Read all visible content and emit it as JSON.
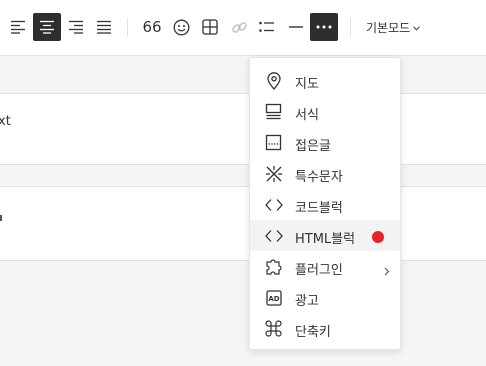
{
  "toolbar": {
    "buttons": [
      {
        "name": "align-left-icon"
      },
      {
        "name": "align-center-icon",
        "active": true
      },
      {
        "name": "align-right-icon"
      },
      {
        "name": "align-justify-icon"
      },
      {
        "name": "quote-icon",
        "glyph": "66"
      },
      {
        "name": "emoji-icon"
      },
      {
        "name": "table-icon"
      },
      {
        "name": "link-icon"
      },
      {
        "name": "list-icon"
      },
      {
        "name": "horizontal-rule-icon"
      },
      {
        "name": "more-icon",
        "active": true
      }
    ],
    "mode_label": "기본모드"
  },
  "editor": {
    "card1_text": "xt",
    "card2_text": ""
  },
  "menu": {
    "items": [
      {
        "label": "지도",
        "icon": "map-pin-icon"
      },
      {
        "label": "서식",
        "icon": "template-icon"
      },
      {
        "label": "접은글",
        "icon": "fold-icon"
      },
      {
        "label": "특수문자",
        "icon": "special-char-icon"
      },
      {
        "label": "코드블럭",
        "icon": "code-icon"
      },
      {
        "label": "HTML블럭",
        "icon": "html-code-icon",
        "hover": true,
        "badge_color": "#e8212a"
      },
      {
        "label": "플러그인",
        "icon": "puzzle-icon",
        "submenu": true
      },
      {
        "label": "광고",
        "icon": "ad-icon"
      },
      {
        "label": "단축키",
        "icon": "command-icon"
      }
    ]
  },
  "colors": {
    "active_bg": "#2e2e2e",
    "badge": "#e8212a",
    "page_bg": "#f4f5f7"
  }
}
